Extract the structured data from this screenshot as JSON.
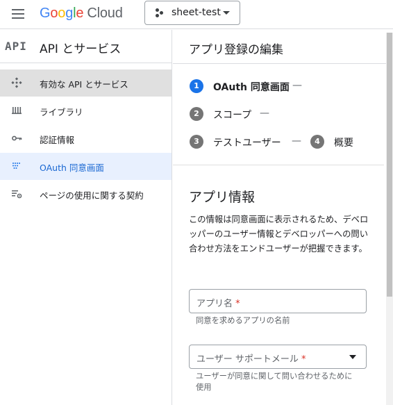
{
  "header": {
    "logo_google": "Google",
    "logo_cloud": "Cloud",
    "project_name": "sheet-test"
  },
  "sidebar": {
    "mark": "API",
    "title": "API とサービス",
    "items": [
      {
        "label": "有効な API とサービス",
        "icon": "enabled-apis-icon"
      },
      {
        "label": "ライブラリ",
        "icon": "library-icon"
      },
      {
        "label": "認証情報",
        "icon": "key-icon"
      },
      {
        "label": "OAuth 同意画面",
        "icon": "oauth-consent-icon"
      },
      {
        "label": "ページの使用に関する契約",
        "icon": "agreements-icon"
      }
    ]
  },
  "main": {
    "title": "アプリ登録の編集",
    "steps": [
      {
        "num": "1",
        "label": "OAuth 同意画面",
        "sep": "—"
      },
      {
        "num": "2",
        "label": "スコープ",
        "sep": "—"
      },
      {
        "num": "3",
        "label": "テストユーザー",
        "sep": "—"
      },
      {
        "num": "4",
        "label": "概要"
      }
    ],
    "section_title": "アプリ情報",
    "section_desc": "この情報は同意画面に表示されるため、デベロッパーのユーザー情報とデベロッパーへの問い合わせ方法をエンドユーザーが把握できます。",
    "fields": {
      "app_name": {
        "label": "アプリ名",
        "required": "*",
        "hint": "同意を求めるアプリの名前"
      },
      "support_email": {
        "label": "ユーザー サポートメール",
        "required": "*",
        "hint": "ユーザーが同意に関して問い合わせるために使用"
      }
    }
  },
  "colors": {
    "accent": "#1a73e8",
    "active_nav_bg": "#e0e0e0",
    "current_nav_bg": "#e8f0fe",
    "required": "#d93025"
  }
}
